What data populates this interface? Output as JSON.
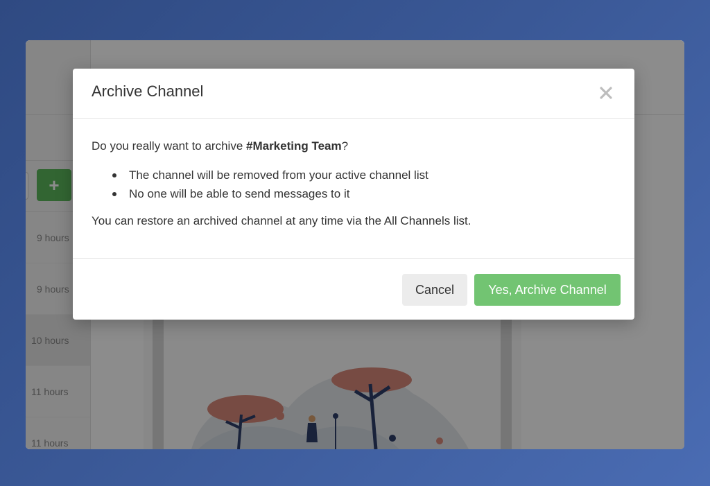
{
  "sidebar": {
    "add_label": "+",
    "time_rows": [
      "9 hours",
      "9 hours",
      "10 hours",
      "11 hours",
      "11 hours"
    ],
    "active_row_index": 2
  },
  "dialog": {
    "title": "Archive Channel",
    "question_prefix": "Do you really want to archive ",
    "channel_name": "#Marketing Team",
    "question_suffix": "?",
    "bullets": [
      "The channel will be removed from your active channel list",
      "No one will be able to send messages to it"
    ],
    "restore_note": "You can restore an archived channel at any time via the All Channels list.",
    "close_icon": "close-icon",
    "cancel_label": "Cancel",
    "confirm_label": "Yes, Archive Channel"
  },
  "colors": {
    "accent_green": "#5cb85c",
    "confirm_green": "#72c472",
    "cancel_gray": "#ececec",
    "background_blue": "#3a5896"
  }
}
